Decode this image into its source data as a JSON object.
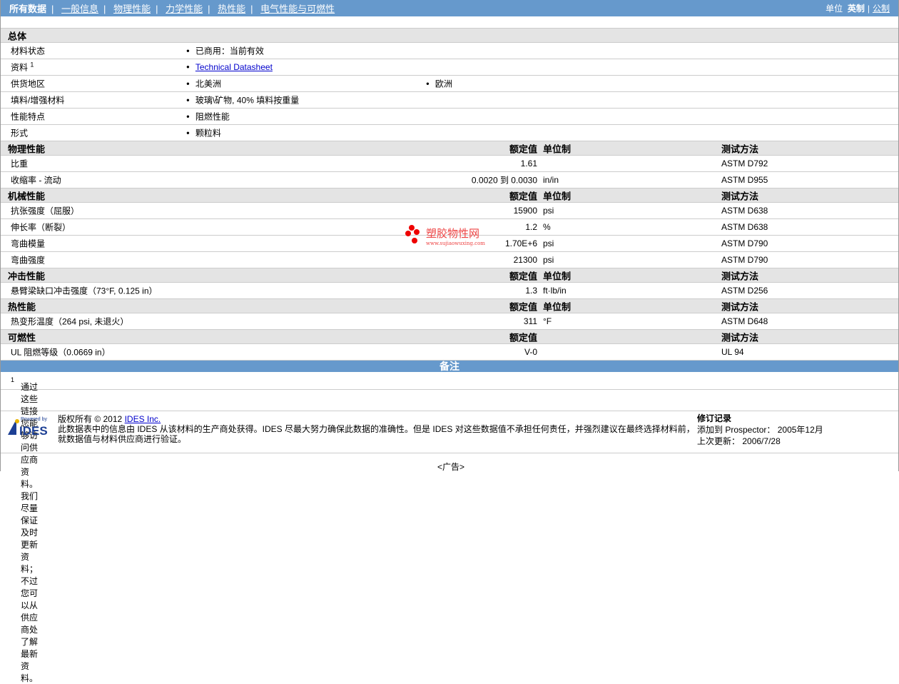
{
  "nav": {
    "items": [
      "所有数据",
      "一般信息",
      "物理性能",
      "力学性能",
      "热性能",
      "电气性能与可燃性"
    ],
    "unit_label": "单位",
    "unit_english": "英制",
    "unit_metric": "公制"
  },
  "general": {
    "title": "总体",
    "rows": [
      {
        "label": "材料状态",
        "values": [
          "已商用：当前有效"
        ]
      },
      {
        "label": "资料",
        "sup": "1",
        "link": "Technical Datasheet"
      },
      {
        "label": "供货地区",
        "values": [
          "北美洲",
          "欧洲"
        ]
      },
      {
        "label": "填料/增强材料",
        "values": [
          "玻璃\\矿物, 40% 填料按重量"
        ]
      },
      {
        "label": "性能特点",
        "values": [
          "阻燃性能"
        ]
      },
      {
        "label": "形式",
        "values": [
          "颗粒料"
        ]
      }
    ]
  },
  "headers": {
    "rated": "额定值",
    "unit": "单位制",
    "test": "测试方法"
  },
  "sections": [
    {
      "title": "物理性能",
      "has_unit": true,
      "rows": [
        {
          "label": "比重",
          "value": "1.61",
          "unit": "",
          "test": "ASTM D792"
        },
        {
          "label": "收缩率 - 流动",
          "value": "0.0020 到  0.0030",
          "unit": "in/in",
          "test": "ASTM D955"
        }
      ]
    },
    {
      "title": "机械性能",
      "has_unit": true,
      "rows": [
        {
          "label": "抗张强度（屈服）",
          "value": "15900",
          "unit": "psi",
          "test": "ASTM D638"
        },
        {
          "label": "伸长率（断裂）",
          "value": "1.2",
          "unit": "%",
          "test": "ASTM D638"
        },
        {
          "label": "弯曲模量",
          "value": "1.70E+6",
          "unit": "psi",
          "test": "ASTM D790"
        },
        {
          "label": "弯曲强度",
          "value": "21300",
          "unit": "psi",
          "test": "ASTM D790"
        }
      ]
    },
    {
      "title": "冲击性能",
      "has_unit": true,
      "rows": [
        {
          "label": "悬臂梁缺口冲击强度（73°F, 0.125 in）",
          "value": "1.3",
          "unit": "ft·lb/in",
          "test": "ASTM D256"
        }
      ]
    },
    {
      "title": "热性能",
      "has_unit": true,
      "rows": [
        {
          "label": "热变形温度（264 psi, 未退火）",
          "value": "311",
          "unit": "°F",
          "test": "ASTM D648"
        }
      ]
    },
    {
      "title": "可燃性",
      "has_unit": false,
      "rows": [
        {
          "label": "UL 阻燃等级（0.0669 in）",
          "value": "V-0",
          "unit": "",
          "test": "UL 94"
        }
      ]
    }
  ],
  "notes": {
    "title": "备注",
    "sup": "1",
    "text": "通过这些链接您能够访问供应商资料。我们尽量保证及时更新资料；不过您可以从供应商处了解最新资料。"
  },
  "footer": {
    "logo_text": "Powered by IDES",
    "copyright": "版权所有 © 2012",
    "company_link": "IDES Inc.",
    "disclaimer1": "此数据表中的信息由 IDES 从该材料的生产商处获得。IDES 尽最大努力确保此数据的准确性。但是 IDES 对这些数据值不承担任何责任，并强烈建议在最终选择材料前，",
    "disclaimer2": "就数据值与材料供应商进行验证。",
    "rev_title": "修订记录",
    "added_label": "添加到 Prospector：",
    "added_date": "2005年12月",
    "updated_label": "上次更新：",
    "updated_date": "2006/7/28"
  },
  "ad": "<广告>",
  "watermark": {
    "name": "塑胶物性网",
    "url": "www.sujiaowuxing.com"
  }
}
